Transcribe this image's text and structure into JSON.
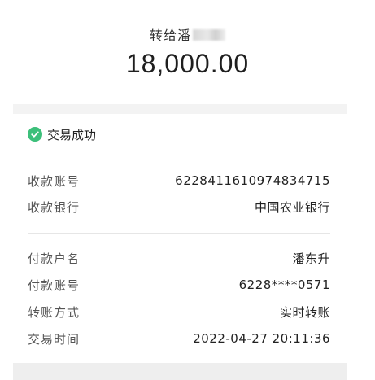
{
  "header": {
    "recipient_prefix": "转给潘",
    "amount": "18,000.00"
  },
  "status": {
    "label": "交易成功",
    "icon": "check-circle-icon",
    "color": "#3cbf7a"
  },
  "payee": {
    "account_label": "收款账号",
    "account_value": "6228411610974834715",
    "bank_label": "收款银行",
    "bank_value": "中国农业银行"
  },
  "payer": {
    "name_label": "付款户名",
    "name_value": "潘东升",
    "account_label": "付款账号",
    "account_value": "6228****0571",
    "method_label": "转账方式",
    "method_value": "实时转账",
    "time_label": "交易时间",
    "time_value": "2022-04-27 20:11:36"
  }
}
